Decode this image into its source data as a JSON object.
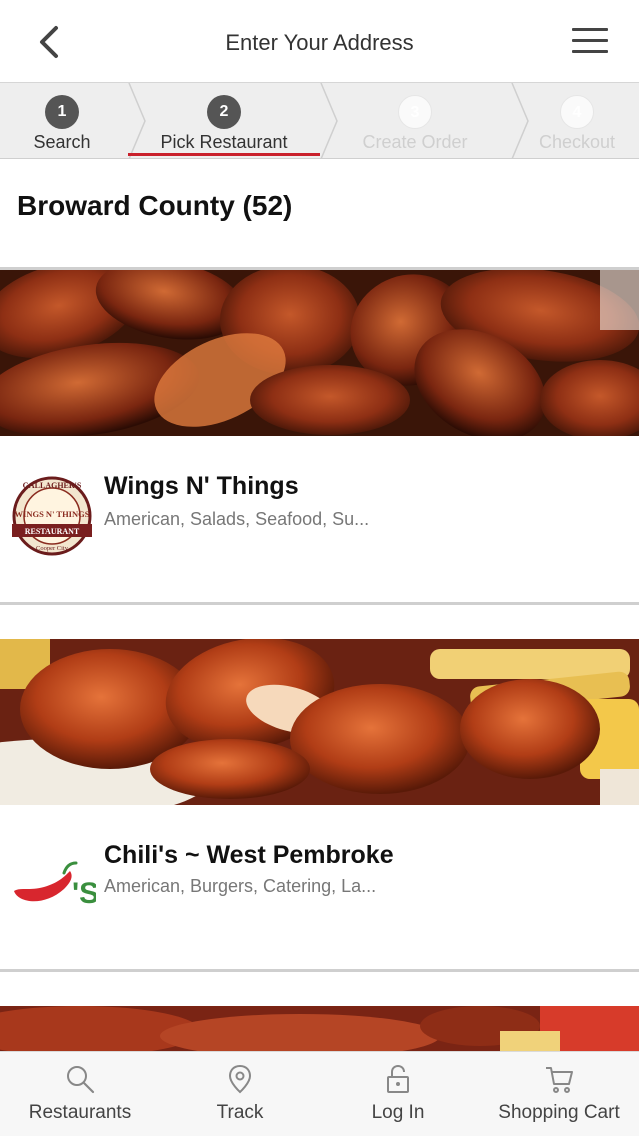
{
  "header": {
    "title": "Enter Your Address",
    "back_icon": "chevron-left-icon",
    "menu_icon": "hamburger-menu-icon"
  },
  "stepper": {
    "steps": [
      {
        "number": "1",
        "label": "Search",
        "state": "done"
      },
      {
        "number": "2",
        "label": "Pick Restaurant",
        "state": "current"
      },
      {
        "number": "3",
        "label": "Create Order",
        "state": "upcoming"
      },
      {
        "number": "4",
        "label": "Checkout",
        "state": "upcoming"
      }
    ]
  },
  "list": {
    "heading": "Broward County (52)",
    "restaurants": [
      {
        "name": "Wings N' Things",
        "cuisine": "American, Salads, Seafood, Su...",
        "logo": "wings-n-things-logo"
      },
      {
        "name": "Chili's ~ West Pembroke",
        "cuisine": "American, Burgers, Catering, La...",
        "logo": "chilis-logo"
      }
    ]
  },
  "logos": {
    "wings": {
      "top_text": "GALLAGHER'S",
      "main_text": "WINGS N' THINGS",
      "banner_text": "RESTAURANT",
      "bottom_text": "Cooper City"
    },
    "chilis": {
      "text": "'S"
    }
  },
  "bottom_nav": {
    "items": [
      {
        "label": "Restaurants",
        "icon": "search-icon"
      },
      {
        "label": "Track",
        "icon": "location-pin-icon"
      },
      {
        "label": "Log In",
        "icon": "lock-icon"
      },
      {
        "label": "Shopping Cart",
        "icon": "cart-icon"
      }
    ]
  },
  "colors": {
    "accent": "#c9202b",
    "chilis_red": "#d8262e",
    "chilis_green": "#3a8f3e"
  }
}
